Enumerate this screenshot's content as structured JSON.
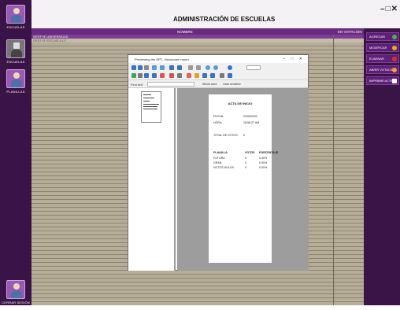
{
  "app": {
    "title": "ADMINISTRACIÓN DE ESCUELAS",
    "window_controls": "–□✕"
  },
  "rail": [
    {
      "label": "ESCUELAS",
      "icon": "users-icon"
    },
    {
      "label": "ESCUELAS",
      "icon": "school-icon"
    },
    {
      "label": "PLANILLAS",
      "icon": "users-icon"
    },
    {
      "label": "CERRAR SESIÓN",
      "icon": "logout-icon"
    }
  ],
  "grid": {
    "columns": [
      "NOMBRE",
      "EN VOTACIÓN"
    ],
    "rows": [
      {
        "name": "GESTYE UNIVERSIDAD",
        "voting": ""
      },
      {
        "name": "GESTYE ESCUELA LO",
        "voting": ""
      }
    ]
  },
  "side_buttons": [
    {
      "label": "AGREGAR",
      "color": "#4caf50"
    },
    {
      "label": "MODIFICAR",
      "color": "#e0b020"
    },
    {
      "label": "ELIMINAR",
      "color": "#d32f2f"
    },
    {
      "label": "ABRIR VOTACIÓN",
      "color": "#f0a030"
    },
    {
      "label": "IMPRIMIR ACTA",
      "color": "#ffffff"
    }
  ],
  "viewer": {
    "title": "Previewing the RPT_Votaciones report",
    "controls": "– □ ✕",
    "search_label": "Find text",
    "opt_whole": "Whole word",
    "opt_case": "Case sensitive",
    "report": {
      "heading": "ACTA DE INICIO",
      "fecha_label": "FECHA:",
      "fecha": "20/05/2022",
      "hora_label": "HORA:",
      "hora": "18:56:27 AM",
      "total_label": "TOTAL DE VOTOS:",
      "total": "0",
      "headers": [
        "PLANILLA",
        "VOTOS",
        "PORCENTAJE"
      ],
      "rows": [
        {
          "name": "FUTURA",
          "votes": "0",
          "pct": "0.00%"
        },
        {
          "name": "GRAN",
          "votes": "0",
          "pct": "0.00%"
        },
        {
          "name": "VOTOS NULOS",
          "votes": "0",
          "pct": "0.00%"
        }
      ]
    }
  }
}
